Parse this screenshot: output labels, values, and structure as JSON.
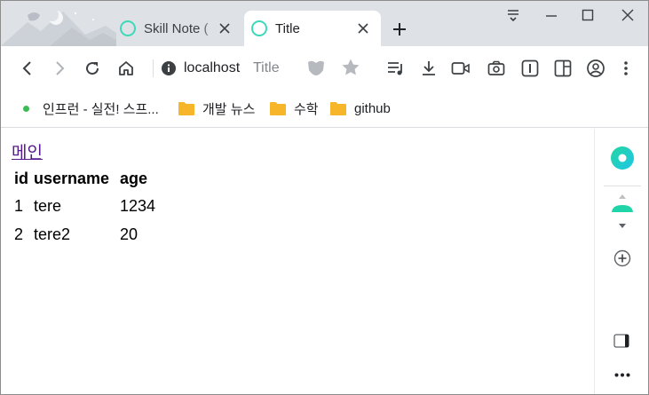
{
  "tabs": [
    {
      "title": "Skill Note (",
      "active": false
    },
    {
      "title": "Title",
      "active": true
    }
  ],
  "address_bar": {
    "host": "localhost",
    "page_title": "Title"
  },
  "bookmarks": [
    {
      "label": "인프런 - 실전! 스프...",
      "icon": "green-dot-icon"
    },
    {
      "label": "개발 뉴스",
      "icon": "folder-icon"
    },
    {
      "label": "수학",
      "icon": "folder-icon"
    },
    {
      "label": "github",
      "icon": "folder-icon"
    }
  ],
  "page": {
    "link_text": "메인",
    "table": {
      "headers": [
        "id",
        "username",
        "age"
      ],
      "rows": [
        [
          "1",
          "tere",
          "1234"
        ],
        [
          "2",
          "tere2",
          "20"
        ]
      ]
    }
  },
  "colors": {
    "tab_strip": "#dee1e6",
    "accent": "#3dd9b9",
    "folder": "#f7b52a",
    "link_visited": "#551a8b"
  }
}
